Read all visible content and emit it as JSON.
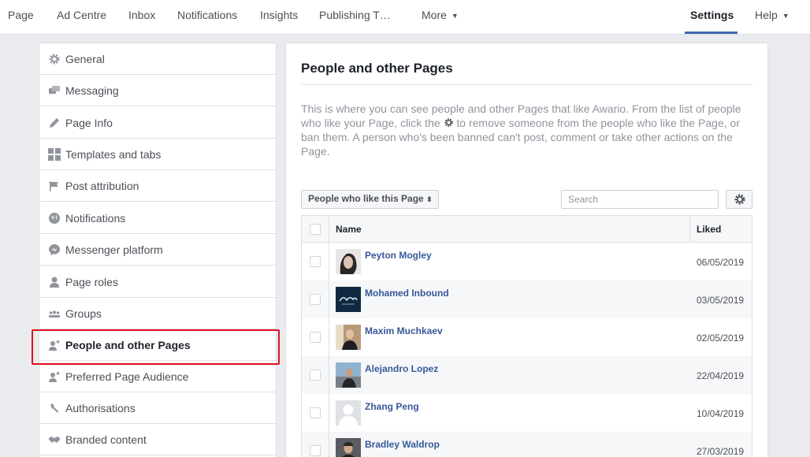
{
  "topnav": {
    "items": [
      "Page",
      "Ad Centre",
      "Inbox",
      "Notifications",
      "Insights",
      "Publishing T…",
      "More"
    ],
    "settings": "Settings",
    "help": "Help"
  },
  "sidebar": {
    "items": [
      {
        "label": "General",
        "icon": "gear-icon"
      },
      {
        "label": "Messaging",
        "icon": "messaging-icon"
      },
      {
        "label": "Page Info",
        "icon": "pencil-icon"
      },
      {
        "label": "Templates and tabs",
        "icon": "grid-icon"
      },
      {
        "label": "Post attribution",
        "icon": "flag-icon"
      },
      {
        "label": "Notifications",
        "icon": "globe-icon"
      },
      {
        "label": "Messenger platform",
        "icon": "messenger-icon"
      },
      {
        "label": "Page roles",
        "icon": "person-icon"
      },
      {
        "label": "Groups",
        "icon": "groups-icon"
      },
      {
        "label": "People and other Pages",
        "icon": "person-star-icon"
      },
      {
        "label": "Preferred Page Audience",
        "icon": "person-star-icon"
      },
      {
        "label": "Authorisations",
        "icon": "wrench-icon"
      },
      {
        "label": "Branded content",
        "icon": "handshake-icon"
      }
    ],
    "active_index": 9
  },
  "main": {
    "title": "People and other Pages",
    "desc_part1": "This is where you can see people and other Pages that like Awario. From the list of people who like your Page, click the",
    "desc_part2": "to remove someone from the people who like the Page, or ban them. A person who's been banned can't post, comment or take other actions on the Page.",
    "filter_label": "People who like this Page",
    "search_placeholder": "Search",
    "table": {
      "col_name": "Name",
      "col_liked": "Liked",
      "rows": [
        {
          "name": "Peyton Mogley",
          "date": "06/05/2019"
        },
        {
          "name": "Mohamed Inbound",
          "date": "03/05/2019"
        },
        {
          "name": "Maxim Muchkaev",
          "date": "02/05/2019"
        },
        {
          "name": "Alejandro Lopez",
          "date": "22/04/2019"
        },
        {
          "name": "Zhang Peng",
          "date": "10/04/2019"
        },
        {
          "name": "Bradley Waldrop",
          "date": "27/03/2019"
        }
      ]
    }
  },
  "colors": {
    "accent": "#4267b2",
    "link": "#365899",
    "highlight": "#e0101a"
  }
}
